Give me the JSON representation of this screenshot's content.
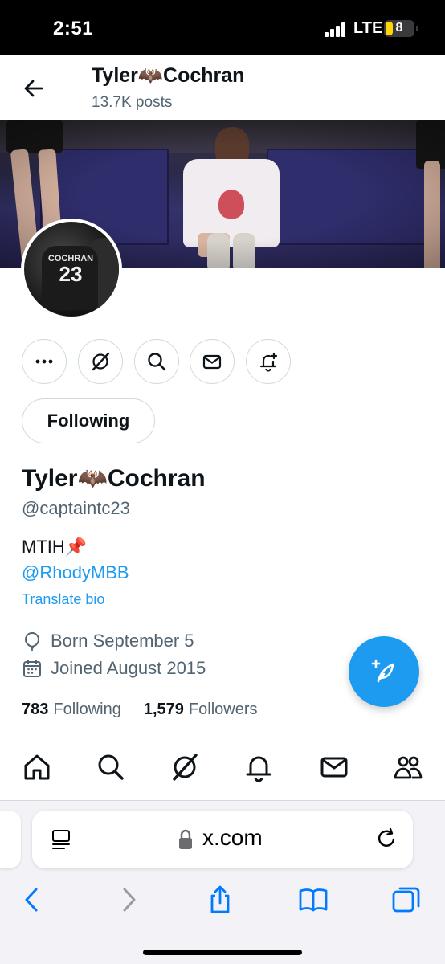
{
  "status_bar": {
    "time": "2:51",
    "network": "LTE",
    "battery": "8"
  },
  "header": {
    "name": "Tyler🦇Cochran",
    "posts": "13.7K posts"
  },
  "avatar": {
    "jersey_name": "COCHRAN",
    "jersey_number": "23"
  },
  "actions": {
    "more": "more-icon",
    "grok": "grok-icon",
    "search": "search-icon",
    "message": "mail-icon",
    "notify": "bell-plus-icon"
  },
  "follow_button": "Following",
  "profile": {
    "name": "Tyler🦇Cochran",
    "handle": "@captaintc23",
    "bio": "MTIH📌",
    "bio_link": "@RhodyMBB",
    "translate": "Translate bio",
    "born": "Born September 5",
    "joined": "Joined August 2015",
    "following_count": "783",
    "following_label": "Following",
    "followers_count": "1,579",
    "followers_label": "Followers"
  },
  "colors": {
    "accent": "#1d9bf0",
    "secondary_text": "#536471",
    "border": "#cfd9de",
    "safari_blue": "#007aff"
  },
  "browser": {
    "url": "x.com"
  }
}
